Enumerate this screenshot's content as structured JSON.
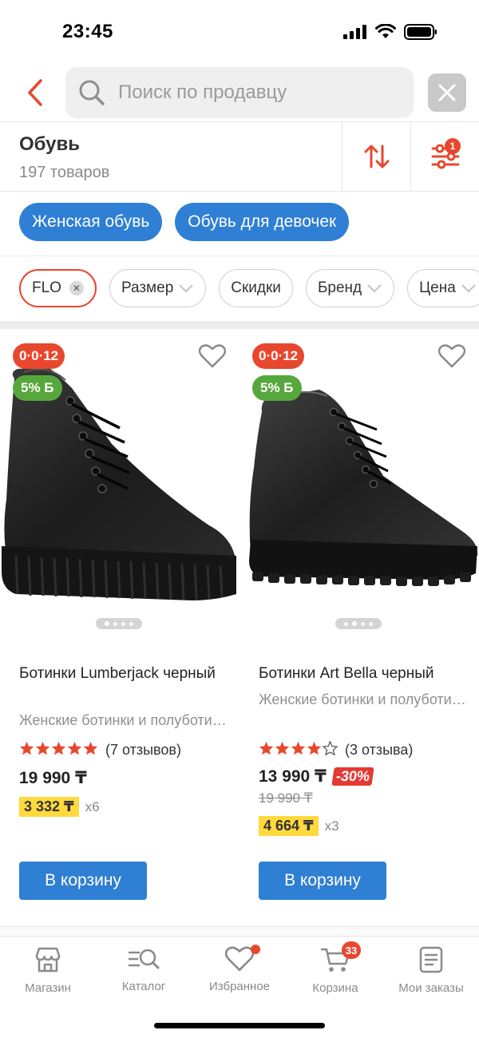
{
  "status_bar": {
    "time": "23:45"
  },
  "search": {
    "placeholder": "Поиск по продавцу"
  },
  "category": {
    "title": "Обувь",
    "count": "197 товаров",
    "filter_badge": "1"
  },
  "subcategories": [
    "Женская обувь",
    "Обувь для девочек"
  ],
  "filter_chips": [
    {
      "label": "FLO",
      "active": true
    },
    {
      "label": "Размер",
      "dropdown": true
    },
    {
      "label": "Скидки"
    },
    {
      "label": "Бренд",
      "dropdown": true
    },
    {
      "label": "Цена",
      "dropdown": true
    }
  ],
  "products": [
    {
      "installment_badge": "0·0·12",
      "bonus_badge": "5% Б",
      "name": "Ботинки Lumberjack черный",
      "description": "Женские ботинки и полуботинки",
      "rating": 5,
      "reviews": "(7 отзывов)",
      "price": "19 990 ₸",
      "old_price": "",
      "discount": "",
      "installment_amount": "3 332 ₸",
      "installment_term": "x6",
      "cart_label": "В корзину",
      "image_dots": 4,
      "active_dot": 0
    },
    {
      "installment_badge": "0·0·12",
      "bonus_badge": "5% Б",
      "name": "Ботинки Art Bella черный",
      "description": "Женские ботинки и полуботинки",
      "rating": 4,
      "reviews": "(3 отзыва)",
      "price": "13 990 ₸",
      "old_price": "19 990 ₸",
      "discount": "-30%",
      "installment_amount": "4 664 ₸",
      "installment_term": "x3",
      "cart_label": "В корзину",
      "image_dots": 4,
      "active_dot": 1
    }
  ],
  "tabbar": [
    {
      "label": "Магазин",
      "icon": "store-icon"
    },
    {
      "label": "Каталог",
      "icon": "catalog-search-icon"
    },
    {
      "label": "Избранное",
      "icon": "heart-icon",
      "dot": true
    },
    {
      "label": "Корзина",
      "icon": "cart-icon",
      "count": "33"
    },
    {
      "label": "Мои заказы",
      "icon": "orders-icon"
    }
  ],
  "colors": {
    "accent_red": "#e8472e",
    "primary_blue": "#2f7fd4",
    "bonus_green": "#57a83c",
    "installment_yellow": "#ffd93d",
    "star_red": "#e8472e"
  }
}
